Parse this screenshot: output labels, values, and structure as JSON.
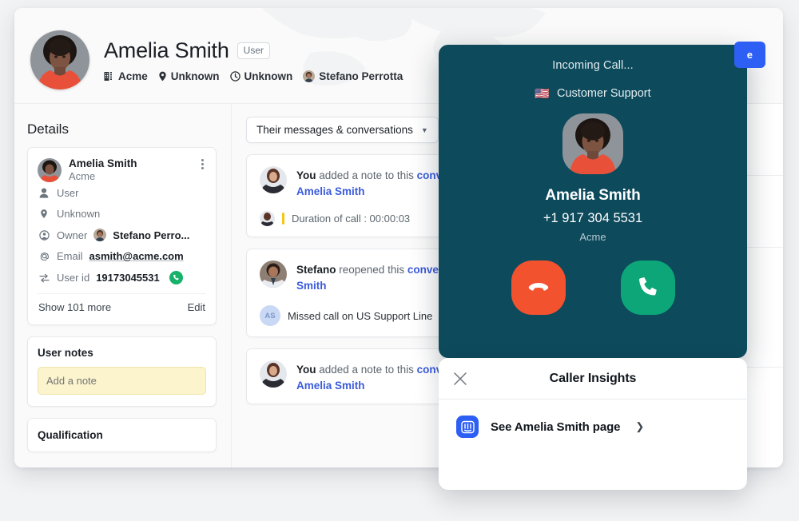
{
  "header": {
    "name": "Amelia Smith",
    "badge": "User",
    "meta": [
      {
        "icon": "building-icon",
        "label": "Acme"
      },
      {
        "icon": "location-pin-icon",
        "label": "Unknown"
      },
      {
        "icon": "clock-icon",
        "label": "Unknown"
      },
      {
        "icon": "owner-avatar",
        "label": "Stefano Perrotta"
      }
    ],
    "action_label": "e"
  },
  "details": {
    "title": "Details",
    "card": {
      "name": "Amelia Smith",
      "org": "Acme",
      "rows": [
        {
          "icon": "person-icon",
          "label": "User",
          "value": ""
        },
        {
          "icon": "location-pin-icon",
          "label": "Unknown",
          "value": ""
        },
        {
          "icon": "globe-icon",
          "label": "Owner",
          "value": "Stefano Perro..."
        },
        {
          "icon": "at-icon",
          "label": "Email",
          "value": "asmith@acme.com"
        },
        {
          "icon": "id-icon",
          "label": "User id",
          "value": "19173045531"
        }
      ],
      "show_more": "Show 101 more",
      "edit": "Edit"
    },
    "notes": {
      "title": "User notes",
      "placeholder": "Add a note"
    },
    "qualification": {
      "title": "Qualification"
    }
  },
  "feed": {
    "filter_label": "Their messages & conversations",
    "items": [
      {
        "actor": "You",
        "action": " added a note to this ",
        "link": "conversation",
        "link2": "Amelia Smith",
        "sub_text": "Duration of call : 00:00:03",
        "sub_type": "note"
      },
      {
        "actor": "Stefano",
        "action": " reopened this ",
        "link": "conversation",
        "link2": "Smith",
        "sub_text": "Missed call on US Support Line",
        "sub_type": "event",
        "sub_initials": "AS"
      },
      {
        "actor": "You",
        "action": " added a note to this ",
        "link": "conversation",
        "link2": "Amelia Smith",
        "sub_text": "",
        "sub_type": "none"
      }
    ]
  },
  "call": {
    "status": "Incoming Call...",
    "flag": "🇺🇸",
    "line_name": "Customer Support",
    "caller_name": "Amelia Smith",
    "caller_number": "+1 917 304 5531",
    "caller_org": "Acme",
    "decline_label": "decline-call",
    "answer_label": "answer-call"
  },
  "insights": {
    "title": "Caller Insights",
    "item_label": "See Amelia Smith page"
  },
  "colors": {
    "call_panel_bg": "#0d4a5c",
    "decline": "#f3522f",
    "answer": "#0da678",
    "accent_blue": "#2d5ff5",
    "link_blue": "#3b5bdb",
    "note_yellow": "#fbf4cd",
    "phone_badge_green": "#16b26a"
  }
}
